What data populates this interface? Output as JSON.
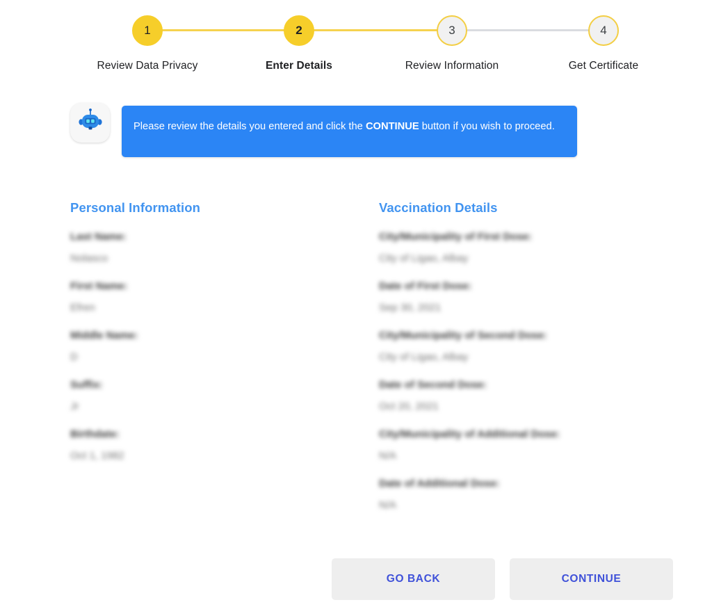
{
  "stepper": {
    "steps": [
      {
        "number": "1",
        "label": "Review Data Privacy",
        "state": "done"
      },
      {
        "number": "2",
        "label": "Enter Details",
        "state": "active"
      },
      {
        "number": "3",
        "label": "Review Information",
        "state": "upcoming"
      },
      {
        "number": "4",
        "label": "Get Certificate",
        "state": "upcoming"
      }
    ],
    "colors": {
      "active": "#F6CE2A",
      "upcoming_fill": "#F1F1F1",
      "upcoming_border": "#F3CE43",
      "connector_filled": "#F6D24F",
      "connector_empty": "#DADCE0"
    }
  },
  "assistant": {
    "avatar_icon": "robot-icon",
    "message_prefix": "Please review the details you entered and click the ",
    "message_emphasis": "CONTINUE",
    "message_suffix": " button if you wish to proceed.",
    "bubble_color": "#2B85F5"
  },
  "personal_information": {
    "title": "Personal Information",
    "title_color": "#4294F0",
    "fields": [
      {
        "label": "Last Name:",
        "value": "Nolasco"
      },
      {
        "label": "First Name:",
        "value": "Efren"
      },
      {
        "label": "Middle Name:",
        "value": "D"
      },
      {
        "label": "Suffix:",
        "value": "Jr"
      },
      {
        "label": "Birthdate:",
        "value": "Oct 1, 1982"
      }
    ]
  },
  "vaccination_details": {
    "title": "Vaccination Details",
    "title_color": "#4294F0",
    "fields": [
      {
        "label": "City/Municipality of First Dose:",
        "value": "City of Ligao, Albay"
      },
      {
        "label": "Date of First Dose:",
        "value": "Sep 30, 2021"
      },
      {
        "label": "City/Municipality of Second Dose:",
        "value": "City of Ligao, Albay"
      },
      {
        "label": "Date of Second Dose:",
        "value": "Oct 20, 2021"
      },
      {
        "label": "City/Municipality of Additional Dose:",
        "value": "N/A"
      },
      {
        "label": "Date of Additional Dose:",
        "value": "N/A"
      }
    ]
  },
  "footer": {
    "go_back_label": "GO BACK",
    "continue_label": "CONTINUE",
    "button_text_color": "#3F51D9"
  }
}
